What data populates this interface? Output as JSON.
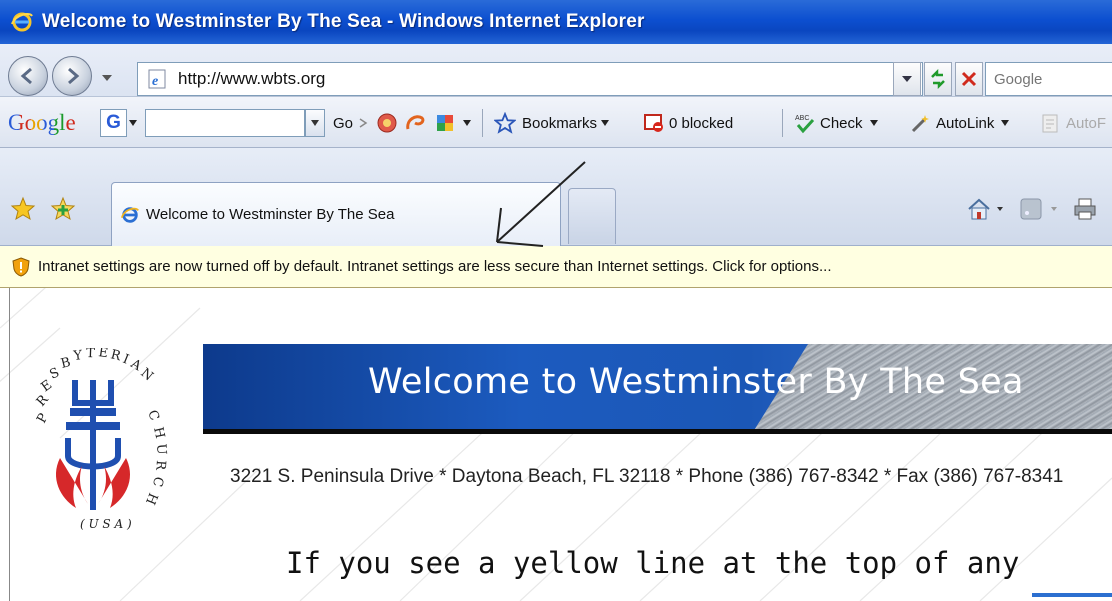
{
  "window": {
    "title": "Welcome to Westminster By The Sea - Windows Internet Explorer"
  },
  "address_bar": {
    "url": "http://www.wbts.org",
    "search_placeholder": "Google"
  },
  "google_toolbar": {
    "logo": "Google",
    "g_button": "G",
    "go_label": "Go",
    "bookmarks_label": "Bookmarks",
    "blocked_label": "0 blocked",
    "check_label": "Check",
    "autolink_label": "AutoLink",
    "autofill_label": "AutoF"
  },
  "tabs": [
    {
      "label": "Welcome to Westminster By The Sea",
      "active": true
    }
  ],
  "info_bar": {
    "message": "Intranet settings are now turned off by default. Intranet settings are less secure than Internet settings. Click for options..."
  },
  "page": {
    "banner_title": "Welcome to Westminster By The Sea",
    "address_line": "3221 S. Peninsula Drive * Daytona Beach, FL 32118 * Phone (386) 767-8342 * Fax (386) 767-8341",
    "logo_text": {
      "presbyterian": "PRESBYTERIAN",
      "church": "CHURCH",
      "usa": "(USA)"
    }
  },
  "caption": "If you see a yellow line at the top of any",
  "colors": {
    "titlebar": "#0c4fd0",
    "infobar": "#ffffe1",
    "banner": "#1c5bbf",
    "logo_blue": "#1f4fb0",
    "logo_red": "#d6282a"
  }
}
